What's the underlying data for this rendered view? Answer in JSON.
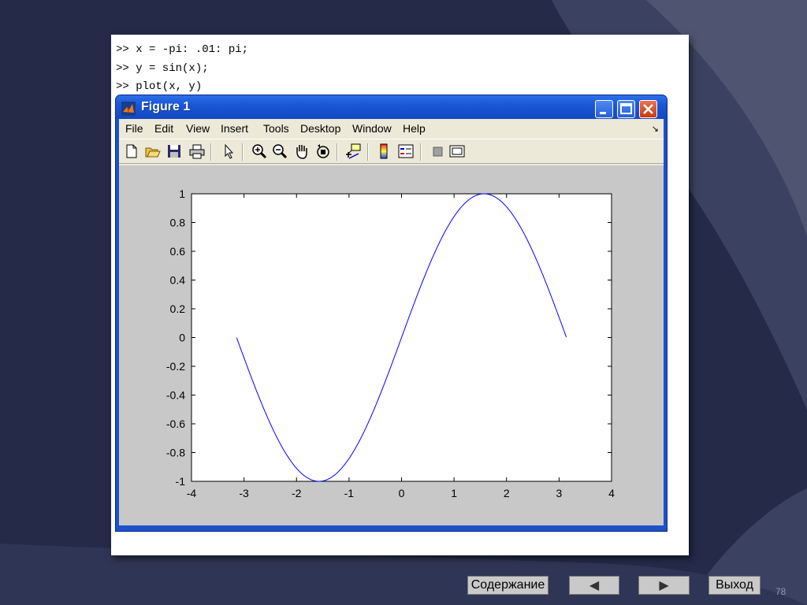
{
  "commands": [
    ">> x = -pi: .01: pi;",
    ">> y = sin(x);",
    ">> plot(x, y)"
  ],
  "window": {
    "title": "Figure 1",
    "menu": [
      "File",
      "Edit",
      "View",
      "Insert",
      "Tools",
      "Desktop",
      "Window",
      "Help"
    ],
    "menu_overflow": "↘",
    "toolbar_icons": [
      "new-file-icon",
      "open-folder-icon",
      "save-icon",
      "print-icon",
      "select-arrow-icon",
      "zoom-in-icon",
      "zoom-out-icon",
      "pan-hand-icon",
      "rotate-3d-icon",
      "data-cursor-icon",
      "insert-colorbar-icon",
      "insert-legend-icon",
      "hide-plot-tools-icon",
      "show-plot-tools-icon"
    ]
  },
  "chart_data": {
    "type": "line",
    "function": "y = sin(x)",
    "x_range": [
      -3.14159,
      3.14159
    ],
    "x_step": 0.01,
    "xlim": [
      -4,
      4
    ],
    "ylim": [
      -1,
      1
    ],
    "xticks": [
      "-4",
      "-3",
      "-2",
      "-1",
      "0",
      "1",
      "2",
      "3",
      "4"
    ],
    "yticks": [
      "1",
      "0.8",
      "0.6",
      "0.4",
      "0.2",
      "0",
      "-0.2",
      "-0.4",
      "-0.6",
      "-0.8",
      "-1"
    ],
    "series": [
      {
        "color": "#0000ff",
        "x": [
          -3.14159,
          -2.8,
          -2.4,
          -2.0,
          -1.5708,
          -1.2,
          -0.8,
          -0.4,
          0,
          0.4,
          0.8,
          1.2,
          1.5708,
          2.0,
          2.4,
          2.8,
          3.14159
        ],
        "y": [
          0,
          -0.335,
          -0.675,
          -0.909,
          -1,
          -0.932,
          -0.717,
          -0.389,
          0,
          0.389,
          0.717,
          0.932,
          1,
          0.909,
          0.675,
          0.335,
          0
        ]
      }
    ],
    "grid": false
  },
  "nav": {
    "contents_label": "Содержание",
    "prev_label": "◀",
    "next_label": "▶",
    "exit_label": "Выход"
  },
  "page_number": "78",
  "colors": {
    "background": "#242a48",
    "swoosh": "#3b4160",
    "titlebar": "#1a57d6",
    "plot_line": "#0000ff"
  }
}
